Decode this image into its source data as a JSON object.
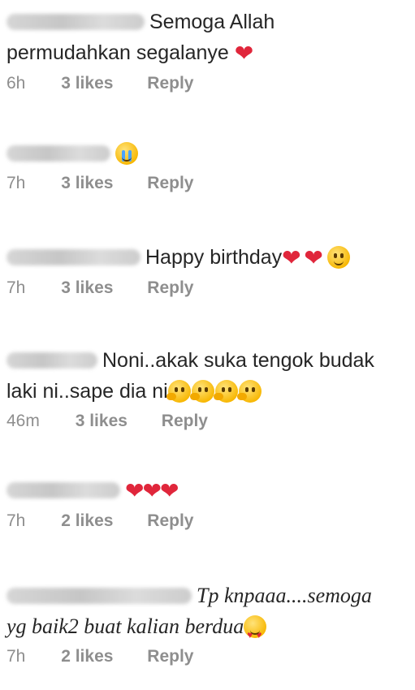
{
  "comments": [
    {
      "text_line1": "Semoga Allah",
      "text_line2": "permudahkan segalanye",
      "time": "6h",
      "likes": "3 likes",
      "reply": "Reply"
    },
    {
      "time": "7h",
      "likes": "3 likes",
      "reply": "Reply"
    },
    {
      "text_line1": "Happy birthday",
      "time": "7h",
      "likes": "3 likes",
      "reply": "Reply"
    },
    {
      "text_line1": "Noni..akak suka tengok budak",
      "text_line2": "laki ni..sape dia ni",
      "time": "46m",
      "likes": "3 likes",
      "reply": "Reply"
    },
    {
      "time": "7h",
      "likes": "2 likes",
      "reply": "Reply"
    },
    {
      "text_line1": "Tp knpaaa....semoga",
      "text_line2": "yg baik2 buat kalian berdua",
      "time": "7h",
      "likes": "2 likes",
      "reply": "Reply"
    }
  ],
  "icons": {
    "heart": "red-heart-icon",
    "crying": "loudly-crying-face-icon",
    "smile": "smiling-face-icon",
    "thinking": "thinking-face-icon",
    "heart_eyes": "heart-eyes-face-icon"
  },
  "colors": {
    "meta": "#8e8e8e",
    "heart": "#e0263b",
    "text": "#262626"
  }
}
